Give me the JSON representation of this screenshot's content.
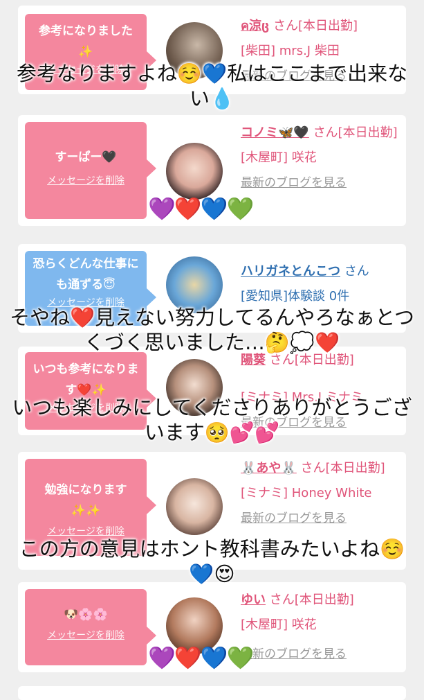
{
  "cards": [
    {
      "bubble": "参考になりました ✨",
      "delete": "メッセージを削除",
      "name": "ค涼ც",
      "suffix": "さん[本日出勤]",
      "shop": "[柴田] mrs.J 柴田",
      "blog": "最新のブログを見る"
    },
    {
      "bubble": "すーぱー🖤",
      "delete": "メッセージを削除",
      "name": "コノミ🦋🖤",
      "suffix": "さん[本日出勤]",
      "shop": "[木屋町] 咲花",
      "blog": "最新のブログを見る"
    },
    {
      "bubble": "恐らくどんな仕事にも通ずる😇",
      "delete": "メッセージを削除",
      "name": "ハリガネとんこつ",
      "suffix": "さん",
      "shop": "[愛知県]体験談 0件",
      "blog": ""
    },
    {
      "bubble": "いつも参考になります❤️✨",
      "delete": "メッセージを削除",
      "name": "陽葵",
      "suffix": "さん[本日出勤]",
      "shop": "[ミナミ] Mrs.J ミナミ",
      "blog": "最新のブログを見る"
    },
    {
      "bubble": "勉強になります ✨✨",
      "delete": "メッセージを削除",
      "name": "🐰あや🐰",
      "suffix": "さん[本日出勤]",
      "shop": "[ミナミ] Honey White",
      "blog": "最新のブログを見る"
    },
    {
      "bubble": "🐶🌸🌸",
      "delete": "メッセージを削除",
      "name": "ゆい",
      "suffix": "さん[本日出勤]",
      "shop": "[木屋町] 咲花",
      "blog": "最新のブログを見る"
    }
  ],
  "overlays": [
    "参考なりますよね☺️💙私はここまで出来ない💧",
    "そやね❤️見えない努力してるんやろなぁとつくづく思いました…🤔💭❤️",
    "いつも楽しみにしてくださりありがとうございます🥺💕💕",
    "この方の意見はホント教科書みたいよね☺️💙😍"
  ],
  "emoji_rows": [
    "💜❤️💙💚",
    "💜❤️💙💚"
  ]
}
